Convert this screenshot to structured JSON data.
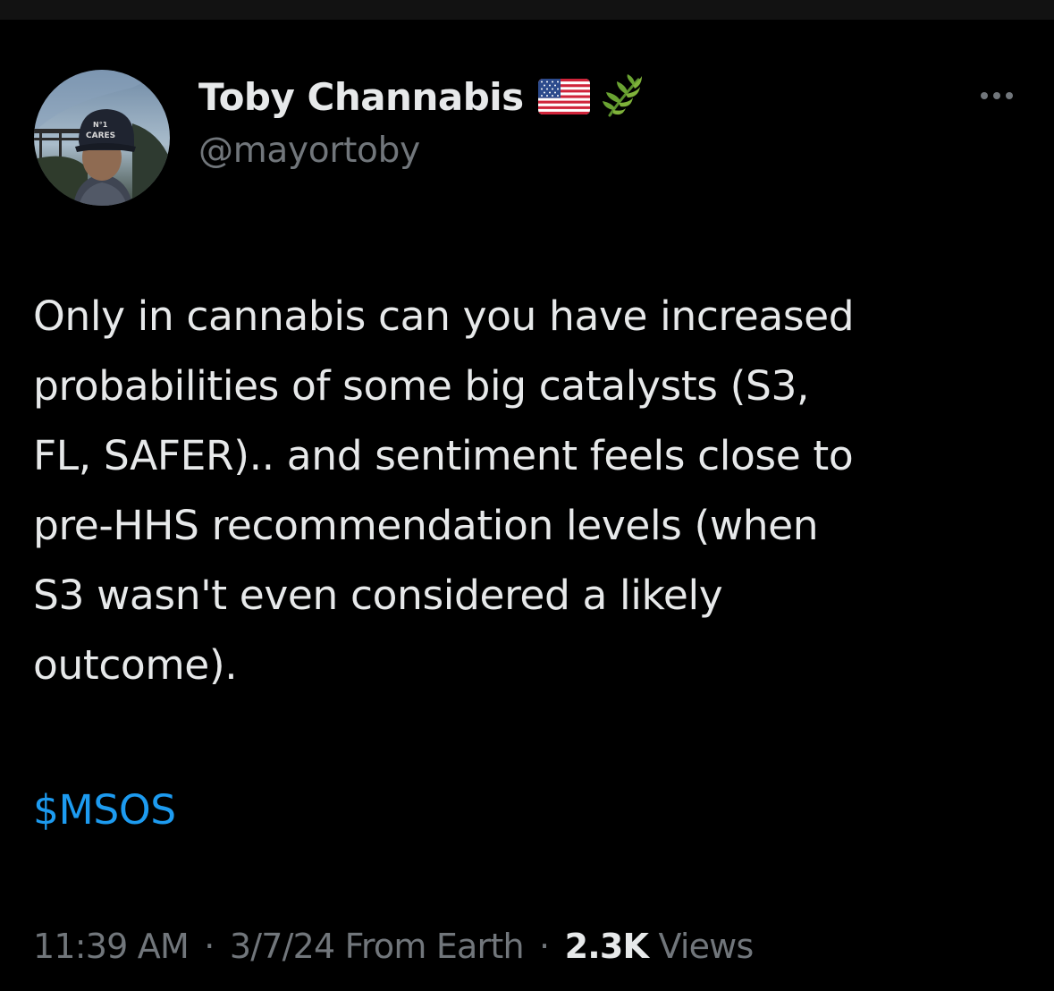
{
  "author": {
    "display_name": "Toby Channabis",
    "handle": "@mayortoby",
    "badges": [
      "us-flag-icon",
      "herb-icon"
    ],
    "avatar_text": "N°1 CARES"
  },
  "tweet": {
    "lines": [
      "Only in cannabis can you have increased",
      "probabilities of some big catalysts (S3,",
      "FL, SAFER).. and sentiment feels close to",
      "pre-HHS recommendation levels (when",
      "S3 wasn't even considered a likely",
      "outcome)."
    ],
    "cashtag": "$MSOS"
  },
  "meta": {
    "time": "11:39 AM",
    "separator": "·",
    "date": "3/7/24",
    "source": "From Earth",
    "views_count": "2.3K",
    "views_label": "Views"
  },
  "colors": {
    "background": "#000000",
    "text": "#e7e9ea",
    "secondary": "#71767b",
    "link": "#1d9bf0"
  }
}
